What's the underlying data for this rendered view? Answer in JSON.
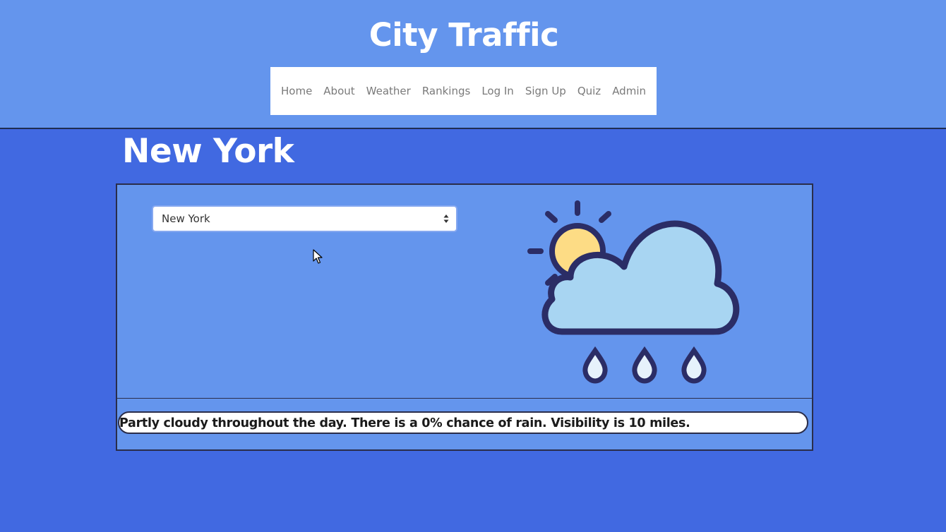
{
  "site": {
    "title": "City Traffic"
  },
  "nav": {
    "items": [
      {
        "label": "Home"
      },
      {
        "label": "About"
      },
      {
        "label": "Weather"
      },
      {
        "label": "Rankings"
      },
      {
        "label": "Log In"
      },
      {
        "label": "Sign Up"
      },
      {
        "label": "Quiz"
      },
      {
        "label": "Admin"
      }
    ]
  },
  "city": {
    "heading": "New York",
    "selected": "New York"
  },
  "weather": {
    "icon": "partly-cloudy-rain-icon",
    "description": "Partly cloudy throughout the day. There is a 0% chance of rain. Visibility is 10 miles."
  },
  "colors": {
    "page_background": "#4169e1",
    "header_background": "#6495ed",
    "panel_background": "#6495ed",
    "outline": "#2a2d4a",
    "cloud": "#a8d5f2",
    "sun": "#fddc85"
  }
}
